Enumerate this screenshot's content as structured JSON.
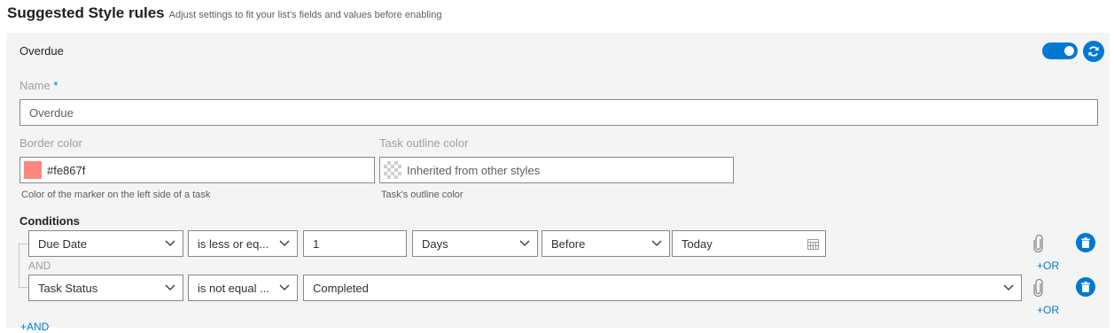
{
  "header": {
    "title": "Suggested Style rules",
    "subtitle": "Adjust settings to fit your list's fields and values before enabling"
  },
  "rule": {
    "name": "Overdue",
    "enabled": true,
    "name_field": {
      "label": "Name",
      "required_mark": "*",
      "value": "Overdue"
    },
    "border_color": {
      "label": "Border color",
      "value": "#fe867f",
      "swatch_color": "#fe867f",
      "hint": "Color of the marker on the left side of a task"
    },
    "outline_color": {
      "label": "Task outline color",
      "value": "Inherited from other styles",
      "hint": "Task's outline color"
    },
    "conditions": {
      "label": "Conditions",
      "and_label": "AND",
      "or_link": "+OR",
      "add_and_link": "+AND",
      "rows": [
        {
          "field": "Due Date",
          "operator": "is less or eq...",
          "amount": "1",
          "unit": "Days",
          "relation": "Before",
          "reference": "Today"
        },
        {
          "field": "Task Status",
          "operator": "is not equal ...",
          "value": "Completed"
        }
      ]
    }
  },
  "icons": {
    "toggle": "toggle-switch-on",
    "refresh": "refresh-icon",
    "calendar": "calendar-icon",
    "attachment": "paperclip-icon",
    "delete": "trash-icon",
    "dropdown": "chevron-down-icon"
  },
  "colors": {
    "accent": "#0078d4",
    "card_bg": "#f4f4f4",
    "border_swatch": "#fe867f"
  }
}
